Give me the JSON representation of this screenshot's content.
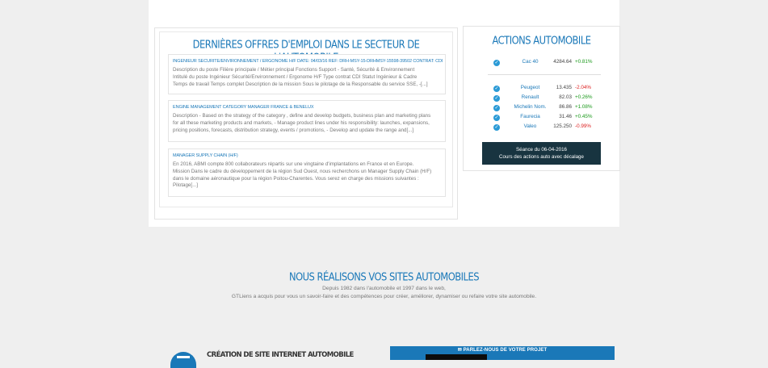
{
  "jobs": {
    "title": "DERNIÈRES OFFRES D'EMPLOI DANS LE SECTEUR DE L'AUTOMOBILE",
    "items": [
      {
        "title": "INGÉNIEUR SÉCURITÉ/ENVIRONNEMENT / ERGONOME H/F DATE: 04/03/16 RÉF: DRH-MSY-15-DRHMSY-15598-39502 CONTRAT: CDI ENTITÉ: SAGEM",
        "lines": [
          "Description du poste Filière principale / Métier principal Fonctions Support - Santé, Sécurité & Environnement",
          "Intitulé du poste Ingénieur Sécurité/Environnement / Ergonome H/F Type contrat CDI Statut Ingénieur & Cadre",
          "Temps de travail Temps complet Description de la mission Sous le pilotage de la Responsable du service SSE, -[...]"
        ]
      },
      {
        "title": "ENGINE MANAGEMENT CATEGORY MANAGER FRANCE & BENELUX",
        "lines": [
          "Description - Based on the strategy of the category , define and develop budgets, business plan and marketing plans",
          "for all these marketing products and markets, - Manage product lines under his responsibility: launches, expansions,",
          "pricing positions, forecasts, distribution strategy, events / promotions, - Develop and update the range and[...]"
        ]
      },
      {
        "title": "MANAGER SUPPLY CHAIN (H/F)",
        "lines": [
          "En 2016, ABMI compte 800 collaborateurs répartis sur une vingtaine d'implantations en France et en Europe.",
          "Mission Dans le cadre du développement de la région Sud Ouest, nous recherchons un Manager Supply Chain (H/F)",
          "dans le domaine aéronautique pour la région Poitou-Charentes. Vous serez en charge des missions suivantes :",
          "Pilotage[...]"
        ]
      }
    ]
  },
  "stocks": {
    "title": "ACTIONS AUTOMOBILE",
    "index": {
      "name": "Cac 40",
      "value": "4284.64",
      "change": "+0.81%",
      "trend": "pos"
    },
    "items": [
      {
        "name": "Peugeot",
        "value": "13.435",
        "change": "-2.04%",
        "trend": "neg"
      },
      {
        "name": "Renault",
        "value": "82.03",
        "change": "+0.26%",
        "trend": "pos"
      },
      {
        "name": "Michelin Nom.",
        "value": "86.86",
        "change": "+1.08%",
        "trend": "pos"
      },
      {
        "name": "Faurecia",
        "value": "31.46",
        "change": "+0.45%",
        "trend": "pos"
      },
      {
        "name": "Valeo",
        "value": "125.250",
        "change": "-0.99%",
        "trend": "neg"
      }
    ],
    "session_line1": "Séance du 06-04-2016",
    "session_line2": "Cours des actions auto avec décalage"
  },
  "sites": {
    "title": "NOUS RÉALISONS VOS SITES AUTOMOBILES",
    "line1": "Depuis 1982 dans l'automobile et 1997 dans le web,",
    "line2": "GTLiens a acquis pour vous un savoir-faire et des compétences pour créer, améliorer, dynamiser ou refaire votre site automobile."
  },
  "creation": {
    "title": "CRÉATION DE SITE INTERNET AUTOMOBILE"
  },
  "contact": {
    "label": "✉ PARLEZ-NOUS DE VOTRE PROJET"
  },
  "colors": {
    "accent": "#1a78b8",
    "positive": "#1c9a1c",
    "negative": "#dd2222",
    "dark": "#183440"
  }
}
